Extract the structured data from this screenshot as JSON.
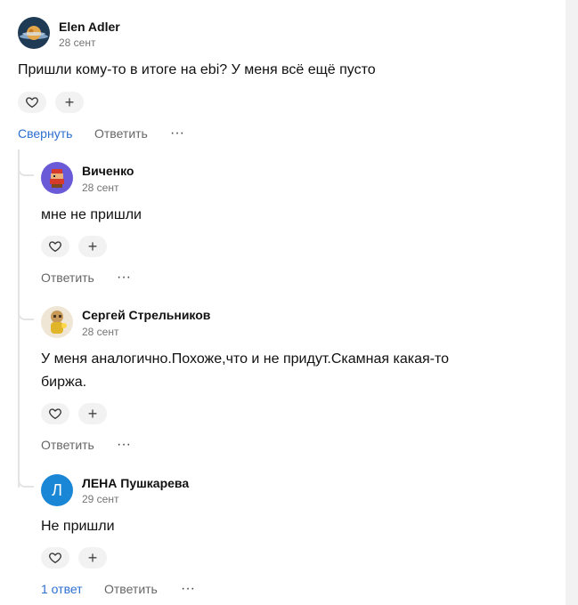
{
  "comments": [
    {
      "author": "Elen Adler",
      "date": "28 сент",
      "text": "Пришли кому-то в итоге на ebi? У меня всё ещё пусто",
      "collapse_label": "Свернуть",
      "reply_label": "Ответить"
    }
  ],
  "replies": [
    {
      "author": "Виченко",
      "date": "28 сент",
      "text": "мне не пришли",
      "reply_label": "Ответить"
    },
    {
      "author": "Сергей Стрельников",
      "date": "28 сент",
      "text_line1": "У меня аналогично.Похоже,что и не придут.Скамная какая-то",
      "text_line2": "биржа.",
      "reply_label": "Ответить"
    },
    {
      "author": "ЛЕНА Пушкарева",
      "date": "29 сент",
      "avatar_letter": "Л",
      "text": "Не пришли",
      "answers_label": "1 ответ",
      "reply_label": "Ответить"
    }
  ],
  "icons": {
    "like": "heart-icon",
    "add_reaction": "plus-icon",
    "more": "more-icon",
    "plus_glyph": "+",
    "dots_glyph": "···"
  },
  "colors": {
    "link_blue": "#2c6fcf",
    "button_bg": "#f2f2f2",
    "lena_avatar": "#1a86d6"
  }
}
